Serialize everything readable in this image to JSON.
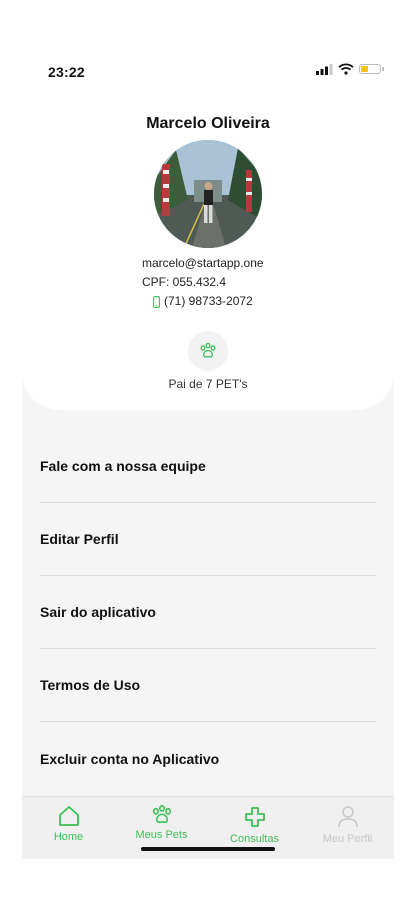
{
  "status_bar": {
    "time": "23:22"
  },
  "profile": {
    "name": "Marcelo Oliveira",
    "email": "marcelo@startapp.one",
    "cpf": "CPF: 055.432.4",
    "phone": "(71) 98733-2072",
    "pets_label": "Pai de 7 PET's"
  },
  "menu": {
    "items": [
      {
        "label": "Fale com a nossa equipe"
      },
      {
        "label": "Editar Perfil"
      },
      {
        "label": "Sair do aplicativo"
      },
      {
        "label": "Termos de Uso"
      },
      {
        "label": "Excluir conta no Aplicativo"
      }
    ]
  },
  "tabs": [
    {
      "label": "Home",
      "icon": "home-icon",
      "state": "active"
    },
    {
      "label": "Meus Pets",
      "icon": "paw-icon",
      "state": "active"
    },
    {
      "label": "Consultas",
      "icon": "medical-cross-icon",
      "state": "active"
    },
    {
      "label": "Meu Perfil",
      "icon": "user-icon",
      "state": "inactive"
    }
  ],
  "colors": {
    "accent": "#3dbf55",
    "inactive": "#c8c8c8",
    "battery": "#f3c316"
  }
}
